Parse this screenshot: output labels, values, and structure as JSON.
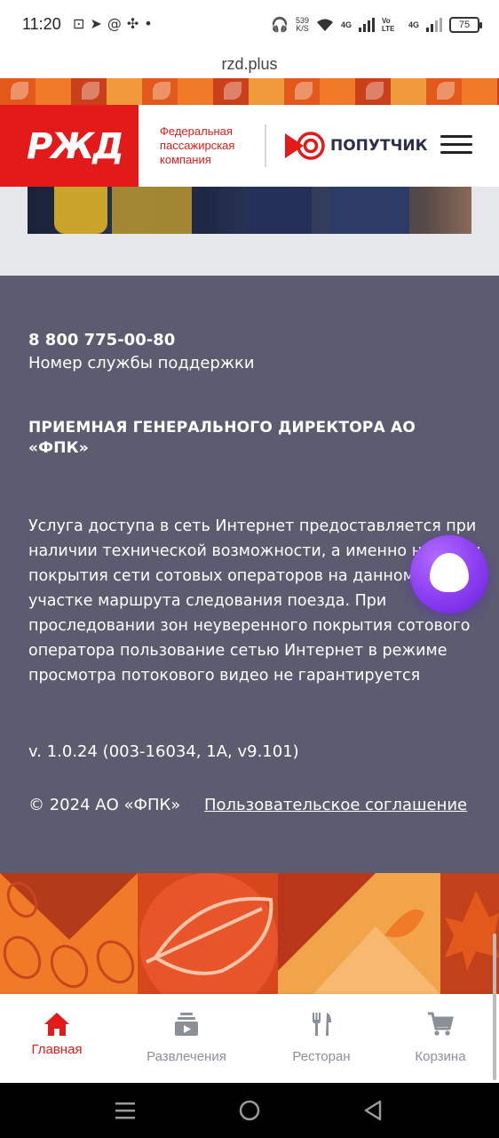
{
  "status_bar": {
    "time": "11:20",
    "speed_value": "539",
    "speed_unit": "K/S",
    "net1": "4G",
    "net2": "Vo LTE",
    "net3": "4G",
    "battery": "75"
  },
  "browser": {
    "url": "rzd.plus"
  },
  "header": {
    "logo_text": "РЖД",
    "company_line1": "Федеральная",
    "company_line2": "пассажирская",
    "company_line3": "компания",
    "service_name": "ПОПУТЧИК"
  },
  "footer": {
    "phone": "8 800 775-00-80",
    "phone_label": "Номер службы поддержки",
    "reception": "ПРИЕМНАЯ ГЕНЕРАЛЬНОГО ДИРЕКТОРА АО «ФПК»",
    "notice": "Услуга доступа в сеть Интернет предоставляется при наличии технической возможности, а именно наличии покрытия сети сотовых операторов на данном участке маршрута следования поезда. При проследовании зон неуверенного покрытия сотового оператора пользование сетью Интернет в режиме просмотра потокового видео не гарантируется",
    "version": "v. 1.0.24 (003-16034, 1A, v9.101)",
    "copyright": "© 2024 АО «ФПК»",
    "agreement": "Пользовательское соглашение"
  },
  "bottom_nav": {
    "items": [
      {
        "label": "Главная",
        "icon": "home-icon",
        "active": true
      },
      {
        "label": "Развлечения",
        "icon": "entertainment-icon",
        "active": false
      },
      {
        "label": "Ресторан",
        "icon": "restaurant-icon",
        "active": false
      },
      {
        "label": "Корзина",
        "icon": "cart-icon",
        "active": false
      }
    ]
  },
  "colors": {
    "brand_red": "#e21a1a",
    "footer_bg": "#5c5c70",
    "alice_purple": "#8a3cf0",
    "nav_inactive": "#8a8f98"
  }
}
